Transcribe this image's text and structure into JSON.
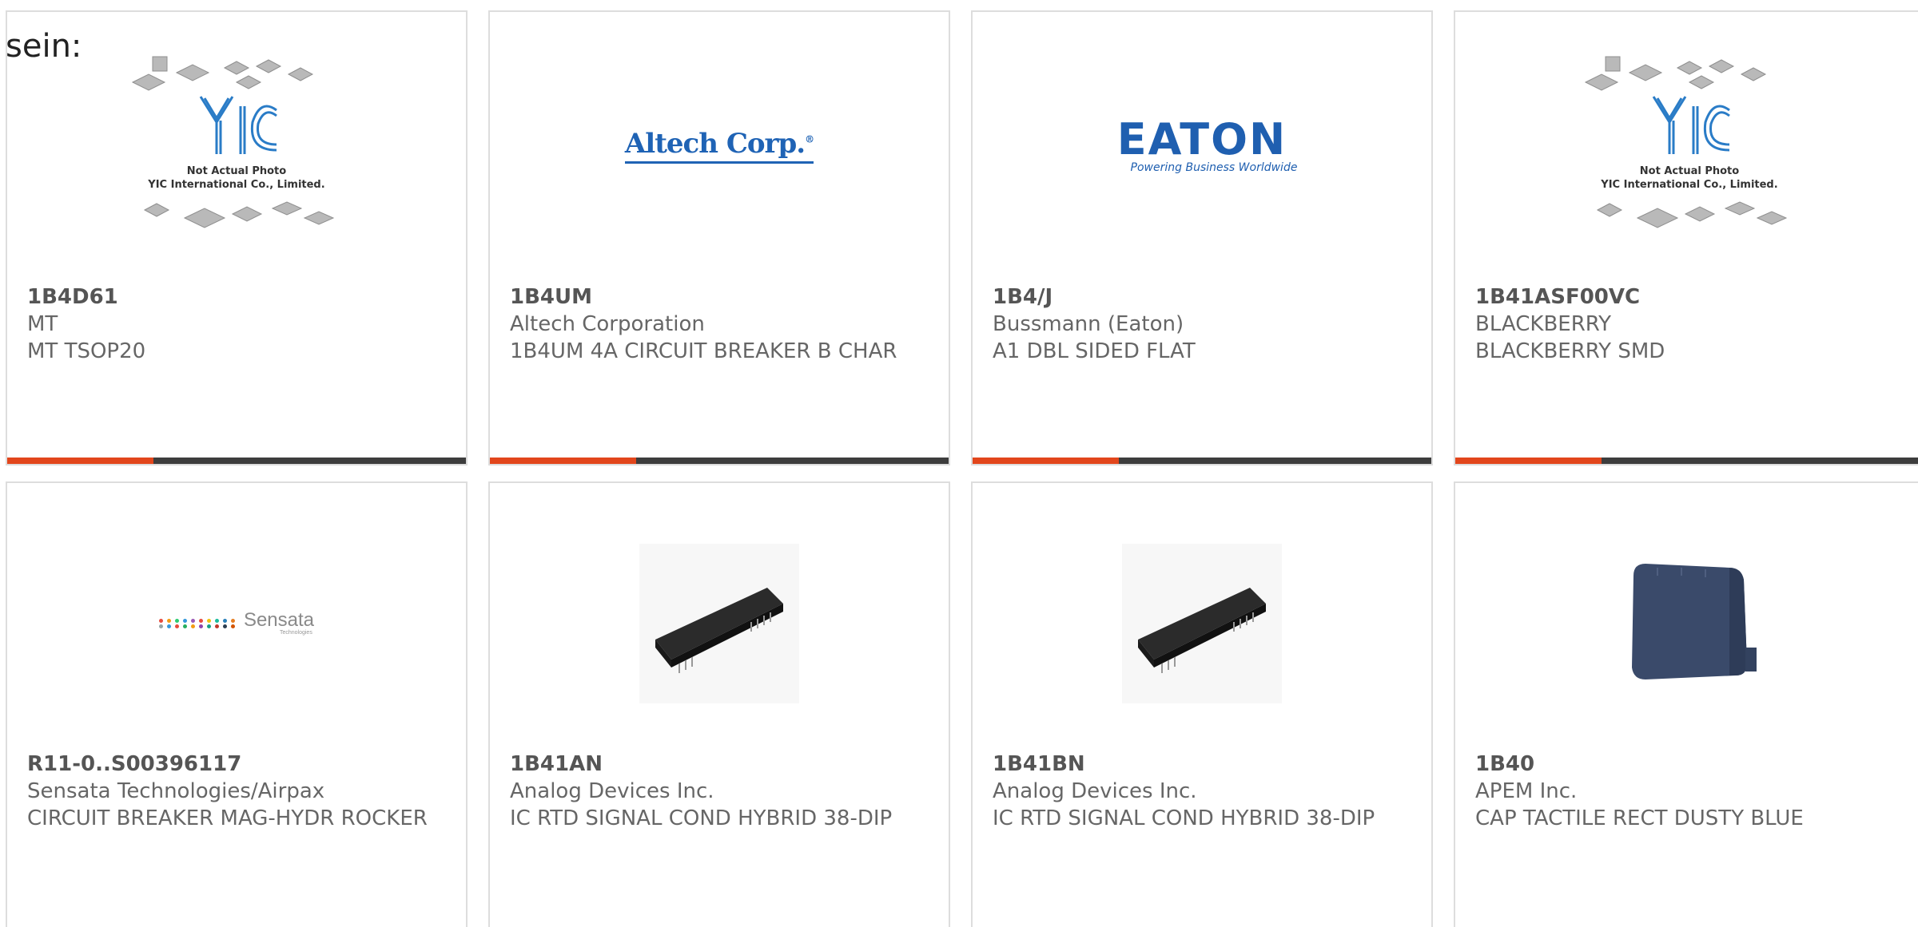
{
  "intro_text": "sein:",
  "colors": {
    "accent": "#e2461c",
    "bar": "#3d3d3d",
    "brand_blue": "#1f5fb0"
  },
  "products": [
    {
      "part_number": "1B4D61",
      "manufacturer": "MT",
      "description": "MT TSOP20",
      "image": "yic-placeholder",
      "placeholder_line1": "Not Actual Photo",
      "placeholder_line2": "YIC International Co., Limited."
    },
    {
      "part_number": "1B4UM",
      "manufacturer": "Altech Corporation",
      "description": "1B4UM 4A CIRCUIT BREAKER B CHAR",
      "image": "altech-logo",
      "logo_text": "Altech Corp."
    },
    {
      "part_number": "1B4/J",
      "manufacturer": "Bussmann (Eaton)",
      "description": "A1 DBL SIDED FLAT",
      "image": "eaton-logo",
      "logo_text": "EATON",
      "logo_tagline": "Powering Business Worldwide"
    },
    {
      "part_number": "1B41ASF00VC",
      "manufacturer": "BLACKBERRY",
      "description": "BLACKBERRY SMD",
      "image": "yic-placeholder",
      "placeholder_line1": "Not Actual Photo",
      "placeholder_line2": "YIC International Co., Limited."
    },
    {
      "part_number": "R11-0..S00396117",
      "manufacturer": "Sensata Technologies/Airpax",
      "description": "CIRCUIT BREAKER MAG-HYDR ROCKER",
      "image": "sensata-logo",
      "logo_text": "Sensata",
      "logo_subtext": "Technologies"
    },
    {
      "part_number": "1B41AN",
      "manufacturer": "Analog Devices Inc.",
      "description": "IC RTD SIGNAL COND HYBRID 38-DIP",
      "image": "dip-module-photo"
    },
    {
      "part_number": "1B41BN",
      "manufacturer": "Analog Devices Inc.",
      "description": "IC RTD SIGNAL COND HYBRID 38-DIP",
      "image": "dip-module-photo"
    },
    {
      "part_number": "1B40",
      "manufacturer": "APEM Inc.",
      "description": "CAP TACTILE RECT DUSTY BLUE",
      "image": "tactile-cap-photo"
    }
  ]
}
